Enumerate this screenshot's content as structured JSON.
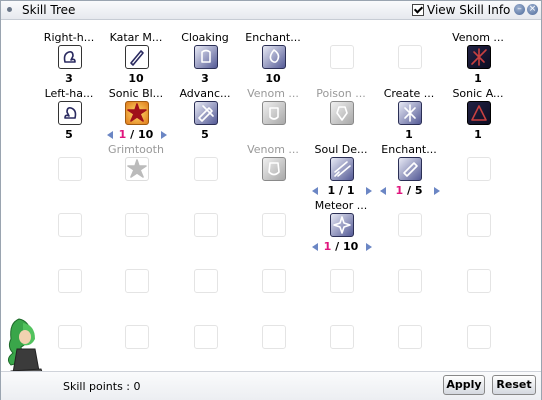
{
  "window": {
    "title": "Skill Tree",
    "view_skill_info_label": "View Skill Info",
    "view_skill_info_checked": true,
    "minimize_symbol": "–",
    "close_symbol": "×"
  },
  "rows": [
    [
      {
        "name": "Right-h...",
        "icon": "right-hand-icon",
        "style": "white",
        "level": "3"
      },
      {
        "name": "Katar M...",
        "icon": "katar-icon",
        "style": "white",
        "level": "10"
      },
      {
        "name": "Cloaking",
        "icon": "cloaking-icon",
        "style": "active",
        "level": "3"
      },
      {
        "name": "Enchant...",
        "icon": "enchant-poison-icon",
        "style": "active",
        "level": "10"
      },
      {
        "empty": true
      },
      {
        "empty": true
      },
      {
        "name": "Venom ...",
        "icon": "venom-dust-icon",
        "style": "dark",
        "level": "1"
      }
    ],
    [
      {
        "name": "Left-ha...",
        "icon": "left-hand-icon",
        "style": "white",
        "level": "5"
      },
      {
        "name": "Sonic Bl...",
        "icon": "sonic-blow-icon",
        "style": "fire",
        "control": {
          "current": "1",
          "max": "10"
        }
      },
      {
        "name": "Advanc...",
        "icon": "advanced-katar-icon",
        "style": "active",
        "level": "5"
      },
      {
        "name": "Venom ...",
        "icon": "venom-knife-icon",
        "style": "gray",
        "dim": true
      },
      {
        "name": "Poison ...",
        "icon": "poison-react-icon",
        "style": "gray",
        "dim": true
      },
      {
        "name": "Create ...",
        "icon": "create-poison-icon",
        "style": "active",
        "level": "1"
      },
      {
        "name": "Sonic A...",
        "icon": "sonic-acceleration-icon",
        "style": "dark",
        "level": "1"
      }
    ],
    [
      {
        "empty": true
      },
      {
        "name": "Grimtooth",
        "icon": "grimtooth-icon",
        "style": "ghost",
        "dim": true
      },
      {
        "empty": true
      },
      {
        "name": "Venom ...",
        "icon": "venom-splasher-icon",
        "style": "gray",
        "dim": true
      },
      {
        "name": "Soul De...",
        "icon": "soul-destroyer-icon",
        "style": "active",
        "control": {
          "current": "1",
          "max": "1",
          "plain": true
        }
      },
      {
        "name": "Enchant...",
        "icon": "enchant-deadly-poison-icon",
        "style": "active",
        "control": {
          "current": "1",
          "max": "5"
        }
      },
      {
        "empty": true
      }
    ],
    [
      {
        "empty": true
      },
      {
        "empty": true
      },
      {
        "empty": true
      },
      {
        "empty": true
      },
      {
        "name": "Meteor ...",
        "icon": "meteor-assault-icon",
        "style": "active",
        "control": {
          "current": "1",
          "max": "10"
        }
      },
      {
        "empty": true
      },
      {
        "empty": true
      }
    ],
    [
      {
        "empty": true
      },
      {
        "empty": true
      },
      {
        "empty": true
      },
      {
        "empty": true
      },
      {
        "empty": true
      },
      {
        "empty": true
      },
      {
        "empty": true
      }
    ],
    [
      {
        "empty": true
      },
      {
        "empty": true
      },
      {
        "empty": true
      },
      {
        "empty": true
      },
      {
        "empty": true
      },
      {
        "empty": true
      },
      {
        "empty": true
      }
    ]
  ],
  "footer": {
    "skill_points_label": "Skill points : 0",
    "apply_label": "Apply",
    "reset_label": "Reset"
  }
}
